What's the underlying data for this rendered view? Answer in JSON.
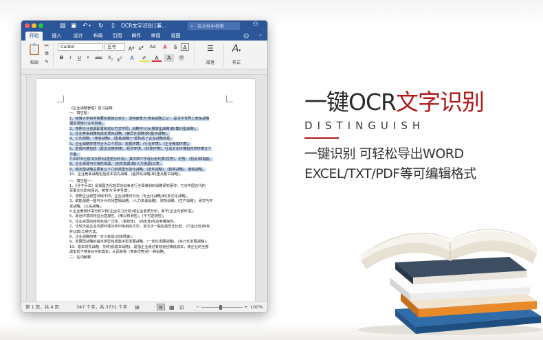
{
  "window": {
    "title": "OCR文字识别 [兼...",
    "search_placeholder": "在文档中搜索"
  },
  "ribbon": {
    "tabs": [
      "开始",
      "插入",
      "设计",
      "布局",
      "引用",
      "邮件",
      "审阅",
      "视图"
    ],
    "active_tab": "开始",
    "paste_label": "粘贴",
    "font_name": "Calibri",
    "font_size": "五号",
    "paragraph_label": "段落",
    "styles_label": "样式"
  },
  "document": {
    "lines": [
      {
        "text": "《企业战略管理》复习提纲：",
        "hl": false
      },
      {
        "text": "一、填空题：",
        "hl": false
      },
      {
        "text": "1、哈佛大学商学院著名教授迈克尔．波特被誉为'竞争战略之父'，是当今世界上竞争战略",
        "hl": true
      },
      {
        "text": "理论领域公认的权威。",
        "hl": true
      },
      {
        "text": "2、按照企业资源配置和增长方式不同，战略可分为(粗放型战略)和(集约型战略)。",
        "hl": true
      },
      {
        "text": "3、企业竞争战略有成本领先战略、(差异化战略)和(集中战略)。",
        "hl": true
      },
      {
        "text": "4、公司战略、(竞争战略)、(职能战略)一起构成了企业战略体系。",
        "hl": true
      },
      {
        "text": "5、企业战略环境可分为三个层次：宏观环境、(行业环境)、(企业微观环境)。",
        "hl": true
      },
      {
        "text": "6、宏观环境包括（政治法律环境)、经济环境、(科技环境)、社会文化环境和自然环境五个",
        "hl": true
      },
      {
        "text": "方面。",
        "hl": true
      },
      {
        "text": "7.SWTO分析法又称为(态势分析法)，其中四个字母分别代表(优势)、劣势、(机会)和威胁。",
        "hl": true
      },
      {
        "text": "8、企业资源可分有形资源、(无形资源)和(人力资源)三类。",
        "hl": true
      },
      {
        "text": "9、稳定型战略主要有以下几种类型无变化战略、(近利战略)、(暂停战略)、谨慎战略。",
        "hl": true
      },
      {
        "text": "10、企业竞争战略包括成本领先战略、(差异化战略)和(重点集中战略)。",
        "hl": false
      },
      {
        "text": "一、填空题一：",
        "hl": false
      },
      {
        "text": "1、《孙子兵法》是我国古代较早对战争进行全局谋划的战略研究著作，它对中国古代的",
        "hl": false
      },
      {
        "text": "军事文化影响深远，被誉为'兵学圣典'。",
        "hl": false
      },
      {
        "text": "2、按照企业经营领域不同，企业战略可分为（专业化战略)和(多元化战略)。",
        "hl": false
      },
      {
        "text": "3、职能战略一般可分为市场营销战略、(人力资源战略)、财务战略、(生产战略)、研究与开",
        "hl": false
      },
      {
        "text": "发战略、(公关战略)。",
        "hl": false
      },
      {
        "text": "4.企业微观环境分析又称(企业实力分析)或企业素质分析，属于(企业内部环境)。",
        "hl": false
      },
      {
        "text": "5、政治环境的特征为直接性、(难以预测性)、(不可逆转性)。",
        "hl": false
      },
      {
        "text": "6、企业资源的特性包括广泛性、(系统性)、(动态性)和运筹稀缺性。",
        "hl": false
      },
      {
        "text": "7、比较法是企业内部环境分析中常用的方法，该方法一般包括历史比较、(行业比较)和标",
        "hl": false
      },
      {
        "text": "杆比较)三种方法。",
        "hl": false
      },
      {
        "text": "8、企业战略的唯一定义就是(创造顾客)。",
        "hl": false
      },
      {
        "text": "9、发展型战略的基本类型包括集中型发展战略、(一体化发展战略)、(多元化发展战略)。",
        "hl": false
      },
      {
        "text": "10、成本领先战略，又称(低成本战略)，是指企业通过有效途径降低成本，使企业的全部",
        "hl": false
      },
      {
        "text": "成本低于竞争对手的成本，从而获得（竞争优势)的一种战略。",
        "hl": false
      },
      {
        "text": "二、名词解释",
        "hl": false
      }
    ]
  },
  "status": {
    "page": "第 1 页，共 4 页",
    "words": "347 个字，共 3731 个字",
    "zoom": "100%"
  },
  "marketing": {
    "headline_black": "一键OCR",
    "headline_red": "文字识别",
    "subtitle": "DISTINGUISH",
    "desc_line1": "一键识别 可轻松导出WORD",
    "desc_line2": "EXCEL/TXT/PDF等可编辑格式"
  },
  "colors": {
    "word_blue": "#2b579a",
    "accent_red": "#b01818",
    "selection": "#c9dcf5"
  }
}
